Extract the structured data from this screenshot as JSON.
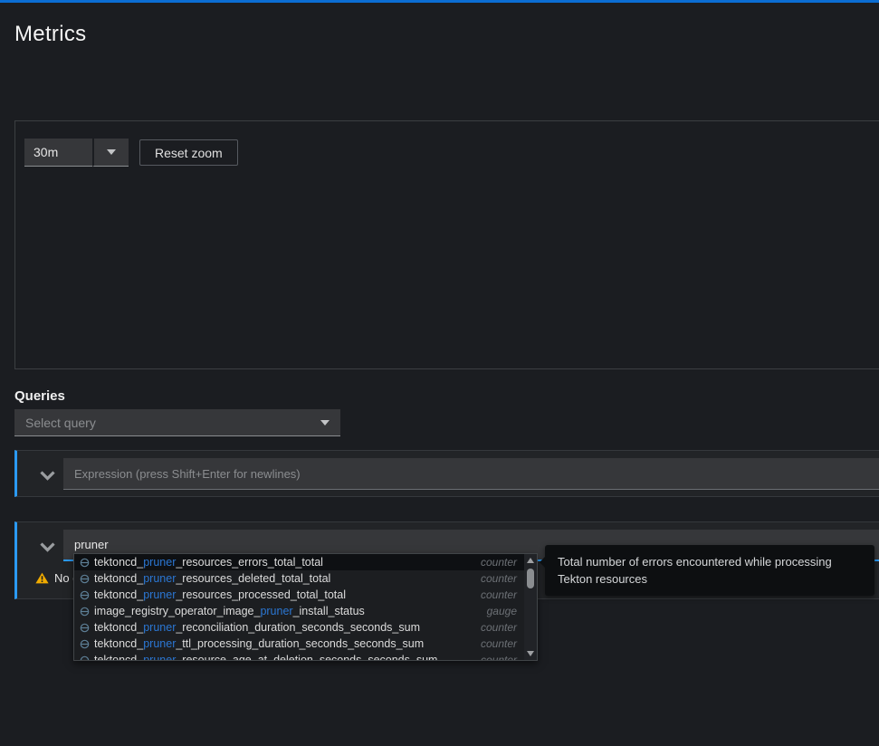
{
  "page": {
    "title": "Metrics"
  },
  "colors": {
    "top_accent_bar": "#0b6dd3",
    "query_row_accent": "#2b9af3",
    "match_highlight": "#2b77d4",
    "warning": "#f0ab00"
  },
  "toolbar": {
    "timespan_value": "30m",
    "reset_zoom_label": "Reset zoom"
  },
  "queries": {
    "heading": "Queries",
    "select_query_placeholder": "Select query",
    "rows": [
      {
        "expression_placeholder": "Expression (press Shift+Enter for newlines)",
        "expression_value": ""
      },
      {
        "expression_value": "pruner",
        "message": "No datapoints found."
      }
    ]
  },
  "autocomplete": {
    "items": [
      {
        "prefix": "tektoncd_",
        "match": "pruner",
        "suffix": "_resources_errors_total_total",
        "type": "counter"
      },
      {
        "prefix": "tektoncd_",
        "match": "pruner",
        "suffix": "_resources_deleted_total_total",
        "type": "counter"
      },
      {
        "prefix": "tektoncd_",
        "match": "pruner",
        "suffix": "_resources_processed_total_total",
        "type": "counter"
      },
      {
        "prefix": "image_registry_operator_image_",
        "match": "pruner",
        "suffix": "_install_status",
        "type": "gauge"
      },
      {
        "prefix": "tektoncd_",
        "match": "pruner",
        "suffix": "_reconciliation_duration_seconds_seconds_sum",
        "type": "counter"
      },
      {
        "prefix": "tektoncd_",
        "match": "pruner",
        "suffix": "_ttl_processing_duration_seconds_seconds_sum",
        "type": "counter"
      },
      {
        "prefix": "tektoncd_",
        "match": "pruner",
        "suffix": "_resource_age_at_deletion_seconds_seconds_sum",
        "type": "counter"
      }
    ]
  },
  "tooltip": {
    "text": "Total number of errors encountered while processing Tekton resources"
  }
}
